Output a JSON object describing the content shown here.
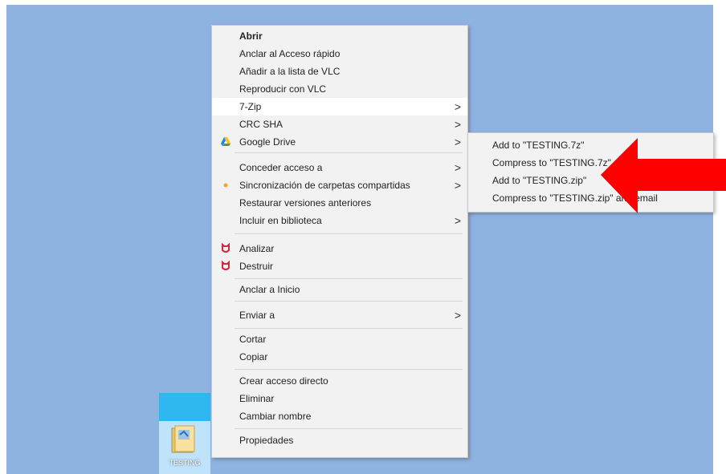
{
  "desktop": {
    "icon_label": "TESTING",
    "bg_color": "#8fb3e0"
  },
  "context_menu": {
    "items": [
      {
        "label": "Abrir"
      },
      {
        "label": "Anclar al Acceso rápido"
      },
      {
        "label": "Añadir a la lista de VLC"
      },
      {
        "label": "Reproducir con VLC"
      },
      {
        "label": "7-Zip"
      },
      {
        "label": "CRC SHA"
      },
      {
        "label": "Google Drive",
        "icon": "google-drive-icon"
      },
      {
        "label": "Conceder acceso a"
      },
      {
        "label": "Sincronización de carpetas compartidas",
        "icon": "sync-icon"
      },
      {
        "label": "Restaurar versiones anteriores"
      },
      {
        "label": "Incluir en biblioteca"
      },
      {
        "label": "Analizar",
        "icon": "antivirus-icon"
      },
      {
        "label": "Destruir",
        "icon": "antivirus-icon"
      },
      {
        "label": "Anclar a Inicio"
      },
      {
        "label": "Enviar a"
      },
      {
        "label": "Cortar"
      },
      {
        "label": "Copiar"
      },
      {
        "label": "Crear acceso directo"
      },
      {
        "label": "Eliminar"
      },
      {
        "label": "Cambiar nombre"
      },
      {
        "label": "Propiedades"
      }
    ],
    "submenu_chevron": ">"
  },
  "zip_submenu": {
    "items": [
      {
        "label": "Add to \"TESTING.7z\""
      },
      {
        "label": "Compress to \"TESTING.7z\" and email"
      },
      {
        "label": "Add to \"TESTING.zip\""
      },
      {
        "label": "Compress to \"TESTING.zip\" and email"
      }
    ]
  },
  "annotation": {
    "arrow_color": "#ff0000"
  }
}
